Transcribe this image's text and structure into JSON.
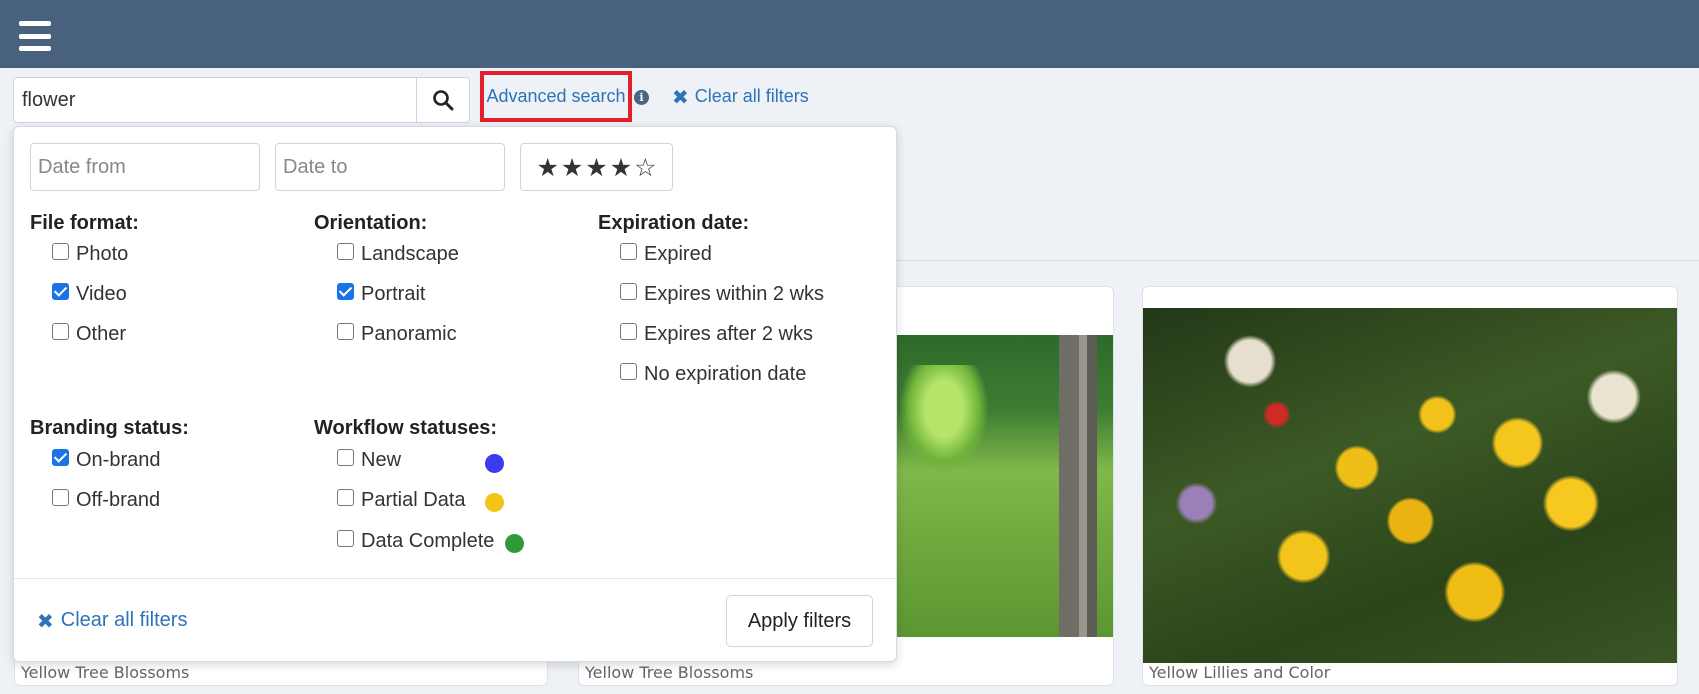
{
  "header": {
    "menu_icon": "hamburger-menu-icon"
  },
  "search": {
    "value": "flower",
    "search_icon": "search-icon",
    "advanced_label": "Advanced search",
    "info_icon": "info-icon",
    "info_glyph": "i",
    "clear_label": "Clear all filters",
    "clear_icon": "close-icon",
    "clear_glyph": "✖"
  },
  "filters": {
    "date_from_placeholder": "Date from",
    "date_to_placeholder": "Date to",
    "rating": {
      "value": 4,
      "max": 5,
      "filled_glyph": "★",
      "empty_glyph": "☆"
    },
    "file_format": {
      "title": "File format:",
      "options": [
        {
          "label": "Photo",
          "checked": false
        },
        {
          "label": "Video",
          "checked": true
        },
        {
          "label": "Other",
          "checked": false
        }
      ]
    },
    "orientation": {
      "title": "Orientation:",
      "options": [
        {
          "label": "Landscape",
          "checked": false
        },
        {
          "label": "Portrait",
          "checked": true
        },
        {
          "label": "Panoramic",
          "checked": false
        }
      ]
    },
    "expiration": {
      "title": "Expiration date:",
      "options": [
        {
          "label": "Expired",
          "checked": false
        },
        {
          "label": "Expires within 2 wks",
          "checked": false
        },
        {
          "label": "Expires after 2 wks",
          "checked": false
        },
        {
          "label": "No expiration date",
          "checked": false
        }
      ]
    },
    "branding": {
      "title": "Branding status:",
      "options": [
        {
          "label": "On-brand",
          "checked": true
        },
        {
          "label": "Off-brand",
          "checked": false
        }
      ]
    },
    "workflow": {
      "title": "Workflow statuses:",
      "options": [
        {
          "label": "New",
          "checked": false,
          "color": "#3b3bf0"
        },
        {
          "label": "Partial Data",
          "checked": false,
          "color": "#f2c515"
        },
        {
          "label": "Data Complete",
          "checked": false,
          "color": "#2f9a3a"
        }
      ]
    },
    "clear_label": "Clear all filters",
    "apply_label": "Apply filters"
  },
  "results": [
    {
      "caption": "Yellow Tree Blossoms"
    },
    {
      "caption": "Yellow Tree Blossoms"
    },
    {
      "caption": "Yellow Lillies and Color"
    }
  ],
  "colors": {
    "topbar": "#48617d",
    "link": "#2d73b8",
    "highlight": "#e0202b",
    "checkbox": "#1a73e8"
  }
}
